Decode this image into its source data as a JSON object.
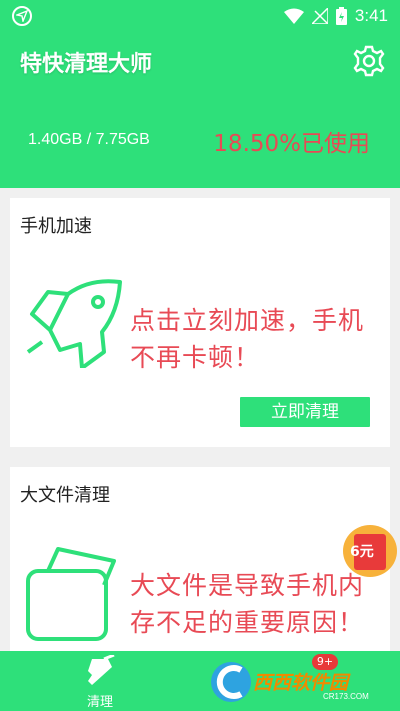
{
  "status_bar": {
    "time": "3:41"
  },
  "header": {
    "title": "特快清理大师",
    "storage": "1.40GB / 7.75GB",
    "usage": "18.50%已使用"
  },
  "cards": [
    {
      "title": "手机加速",
      "message": "点击立刻加速，手机不再卡顿！",
      "button": "立即清理",
      "icon": "rocket-icon"
    },
    {
      "title": "大文件清理",
      "message": "大文件是导致手机内存不足的重要原因！",
      "icon": "folder-icon"
    }
  ],
  "promo": {
    "label": "6元",
    "icon": "red-packet-icon"
  },
  "bottom_nav": {
    "items": [
      {
        "label": "清理",
        "icon": "broom-icon"
      }
    ],
    "badge": "9+"
  },
  "watermark": {
    "text": "西西软件园",
    "sub": "CR173.COM"
  },
  "colors": {
    "primary": "#2ee07a",
    "accent_red": "#e84a55"
  }
}
